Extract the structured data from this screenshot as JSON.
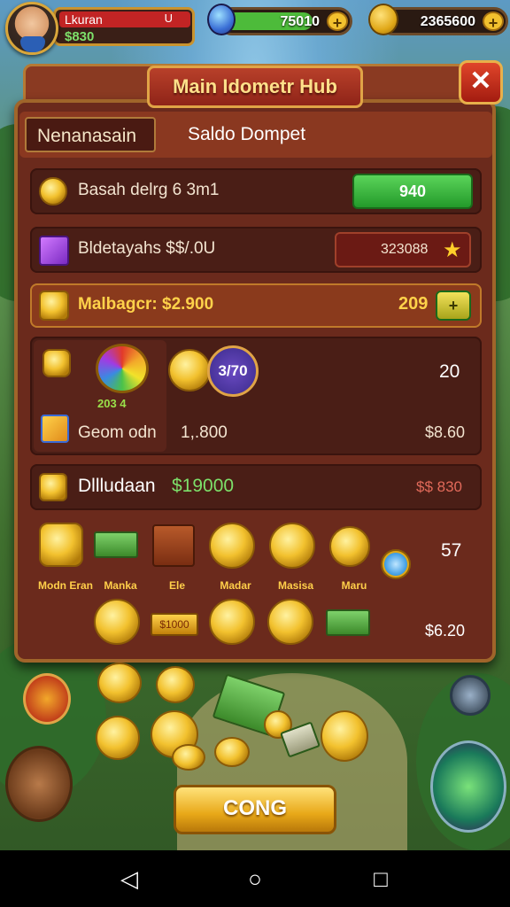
{
  "hud": {
    "player_name": "Lkuran",
    "player_level": "U",
    "player_cash": "$830",
    "gems": "75010",
    "gold": "2365600",
    "plus": "+"
  },
  "panel": {
    "title": "Main Idometr Hub",
    "close": "✕",
    "tabs": [
      "Nenanasain",
      "Saldo Dompet"
    ]
  },
  "rows": {
    "r1": {
      "label": "Basah delrg 6 3m1",
      "button": "940"
    },
    "r2": {
      "label": "Bldetayahs $$/.0U",
      "value": "323088"
    },
    "r3": {
      "label": "Malbagcr: $2.900",
      "value": "209"
    },
    "r4": {
      "badge": "3/70",
      "rainbow_text": "203 4",
      "value_top": "20",
      "label": "Geom odn",
      "amount": "1,.800",
      "value_bottom": "$8.60"
    },
    "r5": {
      "label": "Dllludaan",
      "amount": "$19000",
      "value": "$$ 830"
    }
  },
  "store": {
    "captions": [
      "Modn Eran",
      "Manka",
      "Ele",
      "Madar",
      "Masisa",
      "Maru"
    ],
    "value_top": "57",
    "value_bottom": "$6.20",
    "bar_text": "$1000"
  },
  "cong_button": "CONG",
  "colors": {
    "accent": "#e8a818",
    "panel": "#6b2a1c",
    "green": "#4dbb3a",
    "red": "#c22424"
  }
}
